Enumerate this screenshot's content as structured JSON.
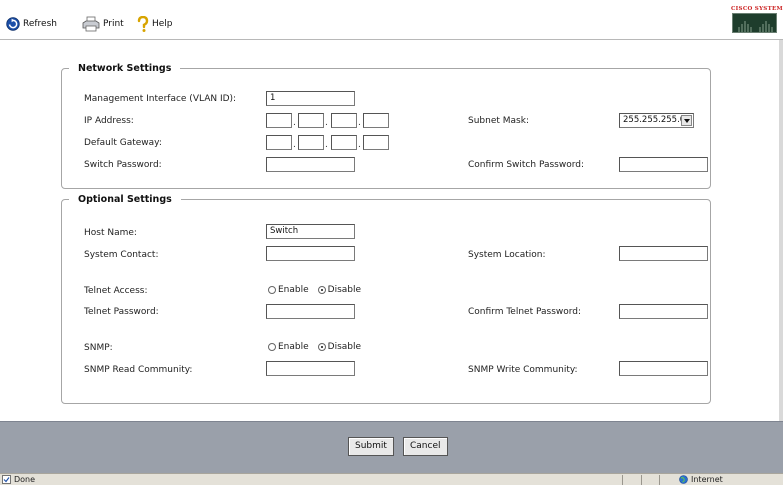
{
  "toolbar": {
    "refresh_label": "Refresh",
    "print_label": "Print",
    "help_label": "Help",
    "logo_text": "Cisco Systems"
  },
  "network_settings": {
    "legend": "Network Settings",
    "mgmt_interface_label": "Management Interface (VLAN ID):",
    "mgmt_interface_value": "1",
    "ip_address_label": "IP Address:",
    "subnet_mask_label": "Subnet Mask:",
    "subnet_mask_value": "255.255.255.0",
    "default_gateway_label": "Default Gateway:",
    "switch_password_label": "Switch Password:",
    "confirm_switch_password_label": "Confirm Switch Password:",
    "octet_separator": "."
  },
  "optional_settings": {
    "legend": "Optional Settings",
    "host_name_label": "Host Name:",
    "host_name_value": "Switch",
    "system_contact_label": "System Contact:",
    "system_location_label": "System Location:",
    "telnet_access_label": "Telnet Access:",
    "telnet_enable_label": "Enable",
    "telnet_disable_label": "Disable",
    "telnet_selected": "Disable",
    "telnet_password_label": "Telnet Password:",
    "confirm_telnet_password_label": "Confirm Telnet Password:",
    "snmp_label": "SNMP:",
    "snmp_enable_label": "Enable",
    "snmp_disable_label": "Disable",
    "snmp_selected": "Disable",
    "snmp_read_label": "SNMP Read Community:",
    "snmp_write_label": "SNMP Write Community:"
  },
  "footer": {
    "submit_label": "Submit",
    "cancel_label": "Cancel"
  },
  "statusbar": {
    "status_text": "Done",
    "zone_text": "Internet"
  },
  "colors": {
    "footer_bar": "#9aa0aa",
    "statusbar": "#e4e1d8",
    "border": "#a6a6a6"
  }
}
